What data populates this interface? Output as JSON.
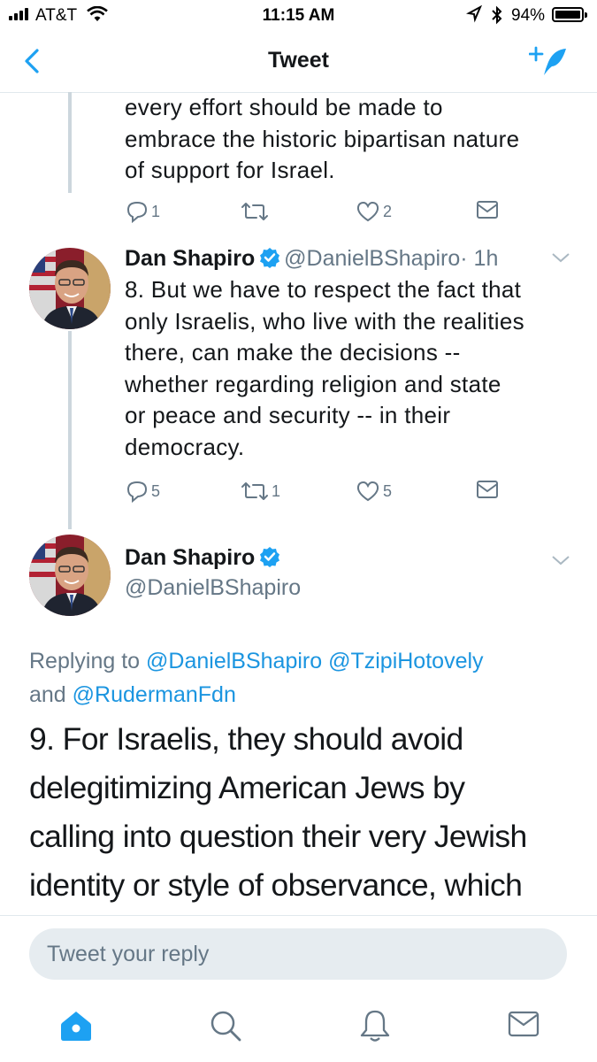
{
  "status_bar": {
    "carrier": "AT&T",
    "time": "11:15 AM",
    "battery": "94%",
    "battery_level": 0.94
  },
  "nav": {
    "title": "Tweet"
  },
  "tweets": [
    {
      "text_lines": [
        "every effort should be made to",
        "embrace the historic bipartisan nature",
        "of support for Israel."
      ],
      "replies": "1",
      "retweets": "",
      "likes": "2"
    },
    {
      "name": "Dan Shapiro",
      "handle": "@DanielBShapiro",
      "time": "· 1h",
      "text_lines": [
        "8. But we have to respect the fact that",
        "only Israelis, who live with the realities",
        "there, can make the decisions --",
        "whether regarding religion and state",
        "or peace and security -- in their",
        "democracy."
      ],
      "replies": "5",
      "retweets": "1",
      "likes": "5"
    }
  ],
  "main_tweet": {
    "name": "Dan Shapiro",
    "handle": "@DanielBShapiro",
    "replying_prefix": "Replying to",
    "mention1": "@DanielBShapiro",
    "mention2": "@TzipiHotovely",
    "and": "and",
    "mention3": "@RudermanFdn",
    "text_lines": [
      "9. For Israelis, they should avoid",
      "delegitimizing American Jews by",
      "calling into question their very Jewish",
      "identity or style of observance, which"
    ]
  },
  "reply_bar": {
    "placeholder": "Tweet your reply"
  },
  "colors": {
    "accent": "#1da1f2",
    "link": "#1b95e0",
    "muted": "#657786"
  },
  "icons": [
    "back-icon",
    "compose-icon",
    "reply-icon",
    "retweet-icon",
    "like-icon",
    "dm-icon",
    "home-icon",
    "search-icon",
    "notifications-icon",
    "messages-icon"
  ]
}
